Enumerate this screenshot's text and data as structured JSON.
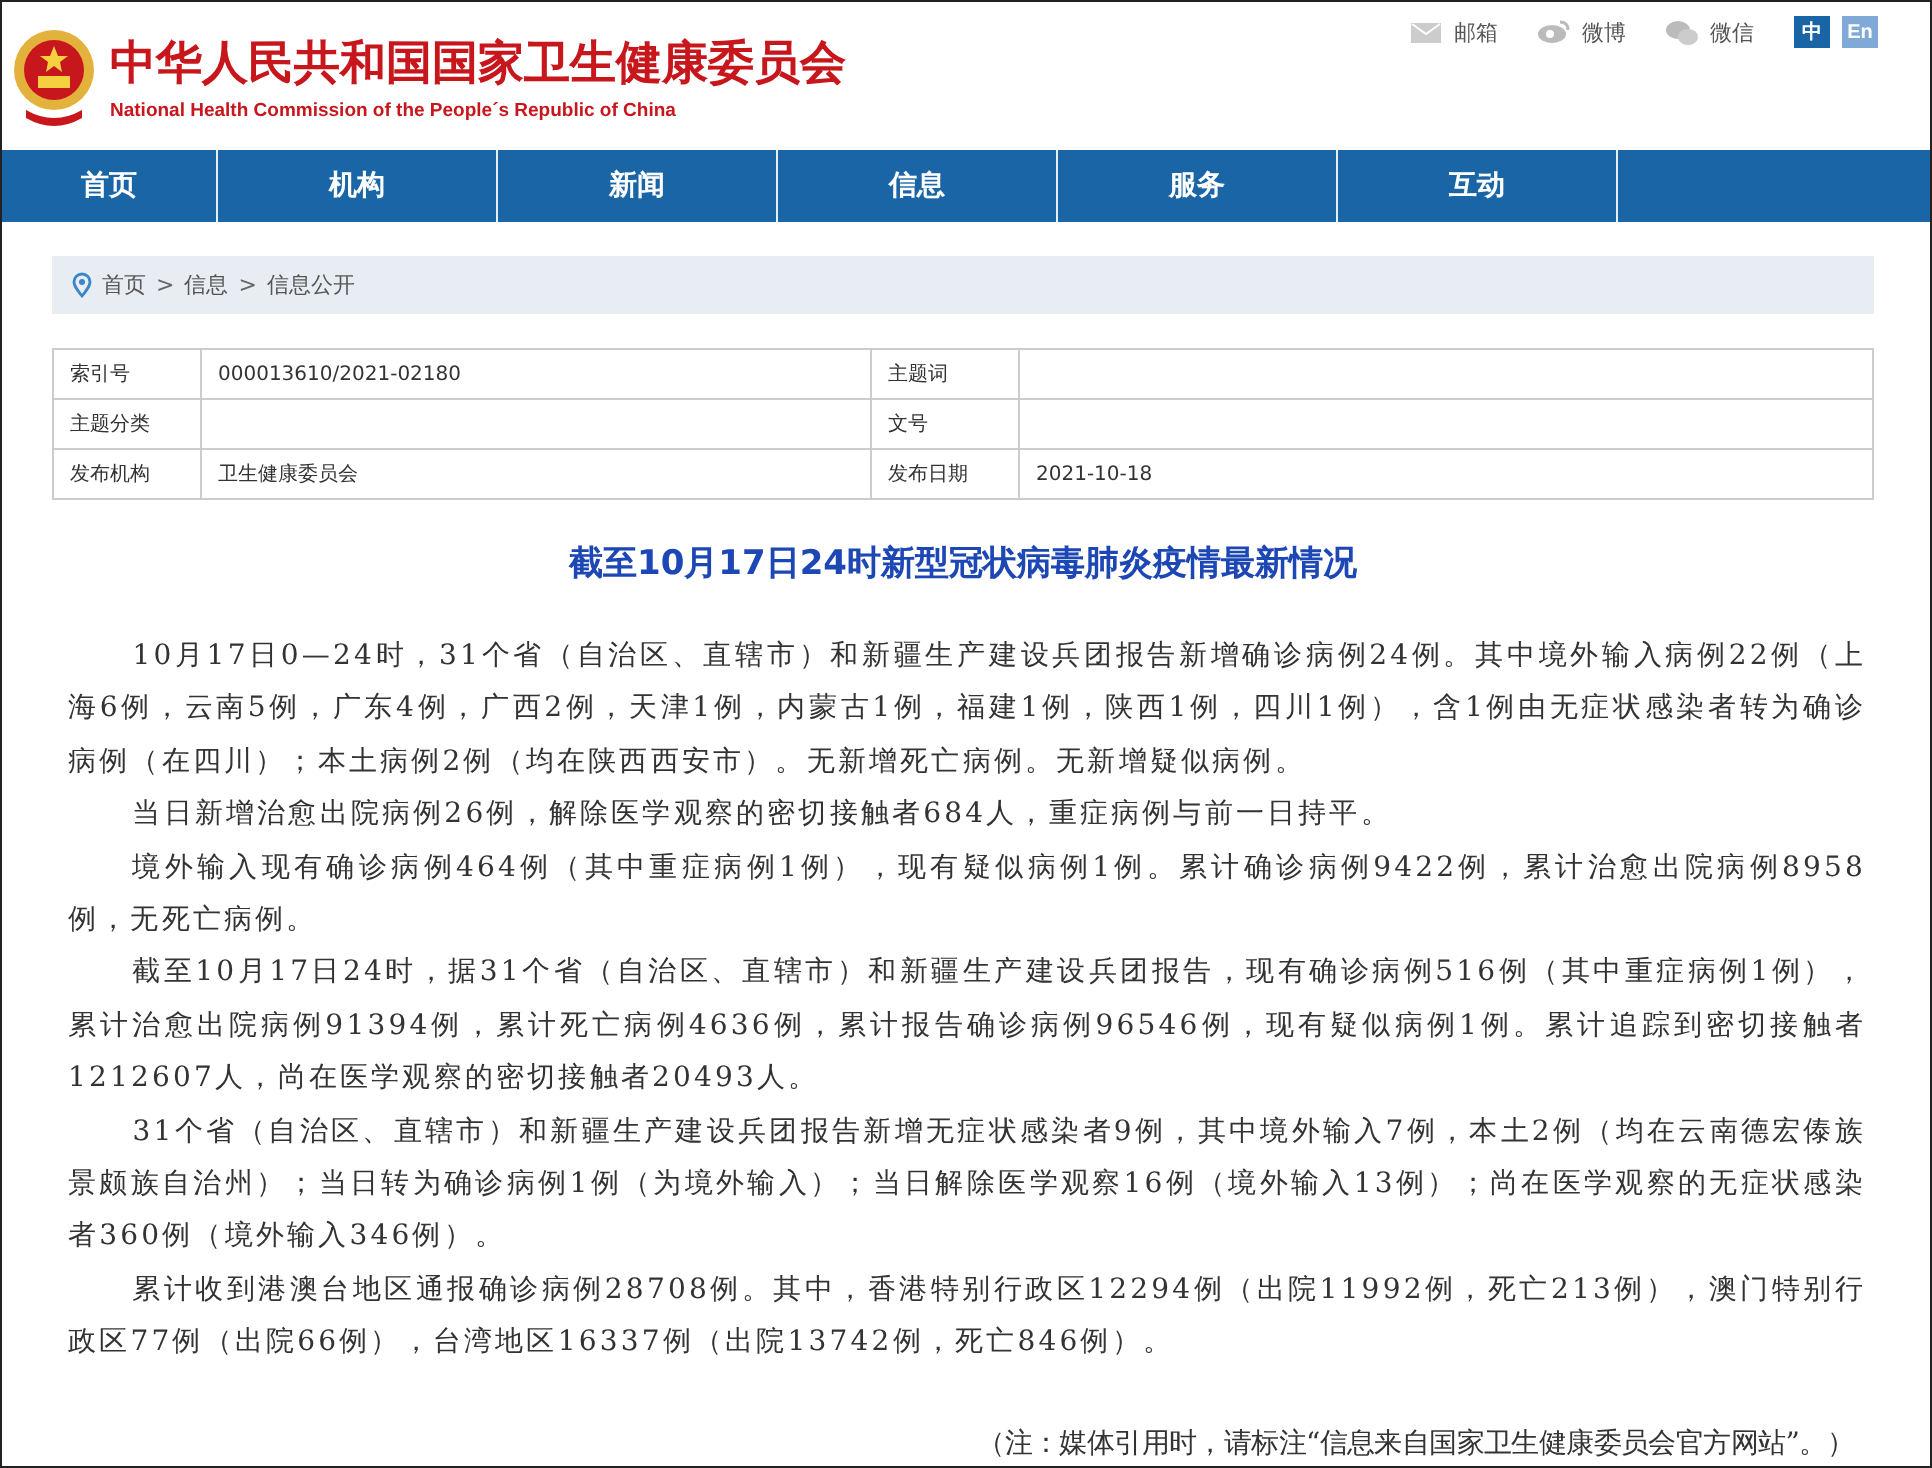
{
  "header": {
    "title": "中华人民共和国国家卫生健康委员会",
    "subtitle": "National Health Commission of the People´s Republic of China",
    "links": [
      "邮箱",
      "微博",
      "微信"
    ],
    "languages": [
      {
        "label": "中",
        "selected": true
      },
      {
        "label": "En",
        "selected": false
      }
    ]
  },
  "nav": [
    "首页",
    "机构",
    "新闻",
    "信息",
    "服务",
    "互动"
  ],
  "breadcrumb": {
    "items": [
      "首页",
      "信息",
      "信息公开"
    ],
    "separator": ">"
  },
  "meta": [
    {
      "label": "索引号",
      "value": "000013610/2021-02180",
      "label2": "主题词"
    },
    {
      "label": "主题分类",
      "label2": "文号"
    },
    {
      "label": "发布机构",
      "value": "卫生健康委员会",
      "label2": "发布日期",
      "value2": "2021-10-18"
    }
  ],
  "article": {
    "title": "截至10月17日24时新型冠状病毒肺炎疫情最新情况",
    "paragraphs": [
      "10月17日0—24时，31个省（自治区、直辖市）和新疆生产建设兵团报告新增确诊病例24例。其中境外输入病例22例（上海6例，云南5例，广东4例，广西2例，天津1例，内蒙古1例，福建1例，陕西1例，四川1例），含1例由无症状感染者转为确诊病例（在四川）；本土病例2例（均在陕西西安市）。无新增死亡病例。无新增疑似病例。",
      "当日新增治愈出院病例26例，解除医学观察的密切接触者684人，重症病例与前一日持平。",
      "境外输入现有确诊病例464例（其中重症病例1例），现有疑似病例1例。累计确诊病例9422例，累计治愈出院病例8958例，无死亡病例。",
      "截至10月17日24时，据31个省（自治区、直辖市）和新疆生产建设兵团报告，现有确诊病例516例（其中重症病例1例），累计治愈出院病例91394例，累计死亡病例4636例，累计报告确诊病例96546例，现有疑似病例1例。累计追踪到密切接触者1212607人，尚在医学观察的密切接触者20493人。",
      "31个省（自治区、直辖市）和新疆生产建设兵团报告新增无症状感染者9例，其中境外输入7例，本土2例（均在云南德宏傣族景颇族自治州）；当日转为确诊病例1例（为境外输入）；当日解除医学观察16例（境外输入13例）；尚在医学观察的无症状感染者360例（境外输入346例）。",
      "累计收到港澳台地区通报确诊病例28708例。其中，香港特别行政区12294例（出院11992例，死亡213例），澳门特别行政区77例（出院66例），台湾地区16337例（出院13742例，死亡846例）。"
    ],
    "note": "（注：媒体引用时，请标注“信息来自国家卫生健康委员会官方网站”。）"
  }
}
